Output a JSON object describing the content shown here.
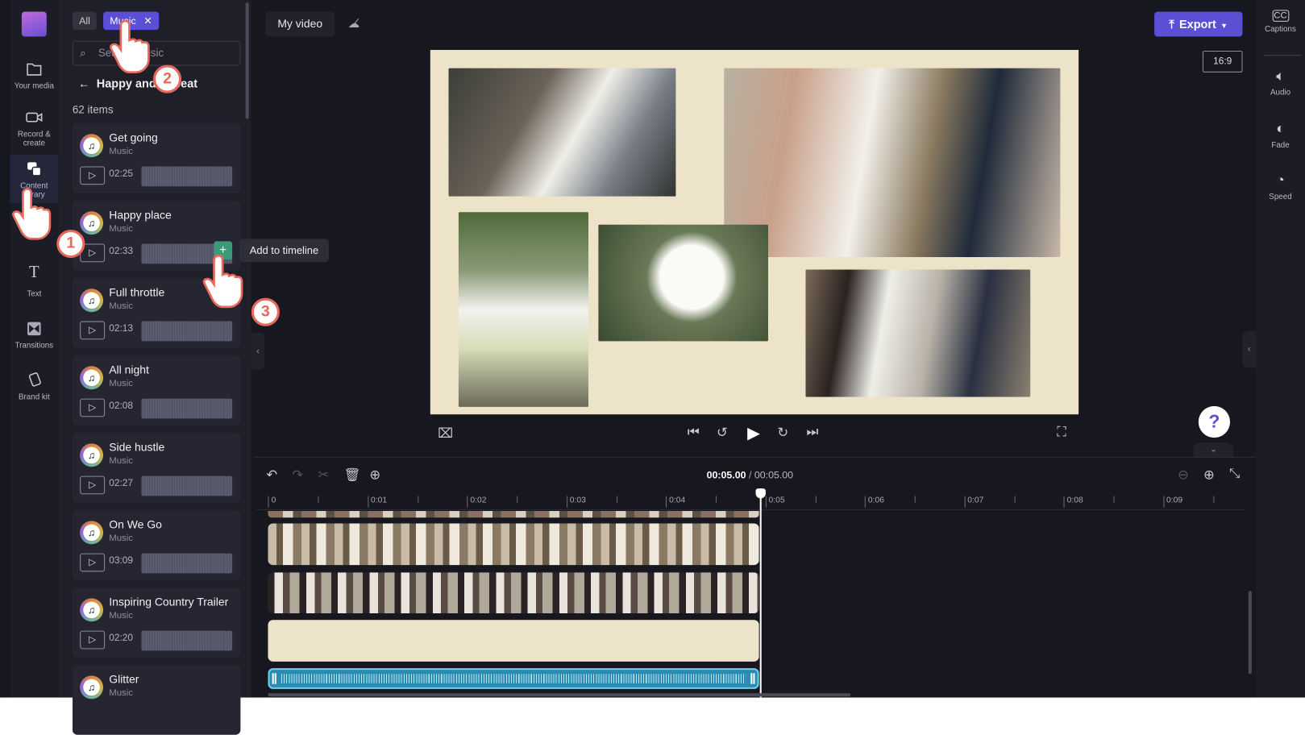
{
  "rail": {
    "items": [
      {
        "label": "Your media",
        "icon": "folder-icon"
      },
      {
        "label": "Record & create",
        "icon": "camera-icon"
      },
      {
        "label": "Content library",
        "icon": "content-library-icon"
      },
      {
        "label": "Text",
        "icon": "text-icon"
      },
      {
        "label": "Transitions",
        "icon": "transitions-icon"
      },
      {
        "label": "Brand kit",
        "icon": "brand-kit-icon"
      }
    ]
  },
  "panel": {
    "filter_all": "All",
    "filter_music": "Music",
    "search_placeholder": "Search music",
    "back_title": "Happy and upbeat",
    "count": "62 items",
    "tooltip": "Add to timeline",
    "tracks": [
      {
        "title": "Get going",
        "type": "Music",
        "duration": "02:25"
      },
      {
        "title": "Happy place",
        "type": "Music",
        "duration": "02:33"
      },
      {
        "title": "Full throttle",
        "type": "Music",
        "duration": "02:13"
      },
      {
        "title": "All night",
        "type": "Music",
        "duration": "02:08"
      },
      {
        "title": "Side hustle",
        "type": "Music",
        "duration": "02:27"
      },
      {
        "title": "On We Go",
        "type": "Music",
        "duration": "03:09"
      },
      {
        "title": "Inspiring Country Trailer",
        "type": "Music",
        "duration": "02:20"
      },
      {
        "title": "Glitter",
        "type": "Music",
        "duration": ""
      }
    ]
  },
  "header": {
    "project_title": "My video",
    "export_label": "Export",
    "aspect_ratio": "16:9"
  },
  "right_rail": {
    "items": [
      {
        "label": "Captions"
      },
      {
        "label": "Audio"
      },
      {
        "label": "Fade"
      },
      {
        "label": "Speed"
      }
    ]
  },
  "help": {
    "label": "?"
  },
  "timeline": {
    "current_time": "00:05.00",
    "separator": " / ",
    "total_time": "00:05.00",
    "ticks": [
      "0",
      "0:01",
      "0:02",
      "0:03",
      "0:04",
      "0:05",
      "0:06",
      "0:07",
      "0:08",
      "0:09"
    ]
  },
  "annotations": {
    "step1": "1",
    "step2": "2",
    "step3": "3"
  },
  "colors": {
    "accent": "#5b4fd6",
    "canvas": "#ede3c8",
    "audio_clip": "#2a8cb0",
    "add_button": "#3c9a78"
  }
}
